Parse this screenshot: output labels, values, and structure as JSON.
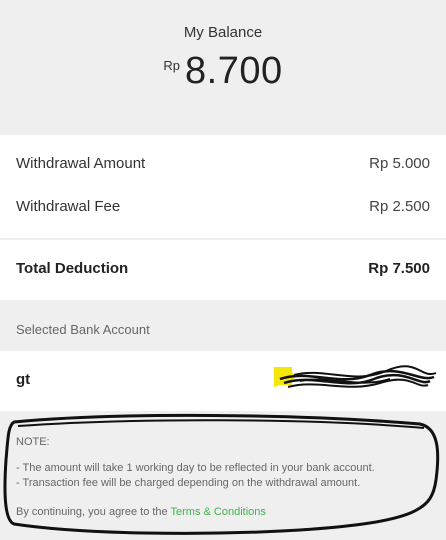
{
  "balance": {
    "title": "My Balance",
    "currency": "Rp",
    "amount": "8.700"
  },
  "withdrawal": {
    "amount_label": "Withdrawal Amount",
    "amount_value": "Rp 5.000",
    "fee_label": "Withdrawal Fee",
    "fee_value": "Rp 2.500"
  },
  "total": {
    "label": "Total Deduction",
    "value": "Rp 7.500"
  },
  "bank": {
    "section_label": "Selected Bank Account",
    "name": "gt"
  },
  "note": {
    "title": "NOTE:",
    "line1": "- The amount will take 1 working day to be reflected in your bank account.",
    "line2": "- Transaction fee will be charged depending on the withdrawal amount."
  },
  "terms": {
    "prefix": "By continuing, you agree to the",
    "link": "Terms & Conditions"
  },
  "colors": {
    "link": "#3db34a",
    "highlight": "#f5e60a",
    "background": "#efefef"
  }
}
